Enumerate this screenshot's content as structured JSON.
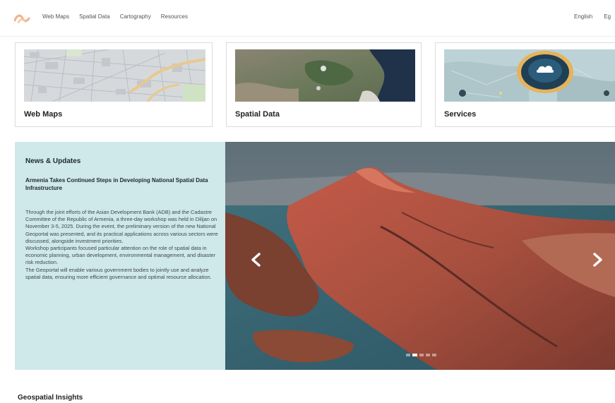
{
  "nav": {
    "links": [
      "Web Maps",
      "Spatial Data",
      "Cartography",
      "Resources"
    ],
    "languages": [
      "English",
      "Eg"
    ]
  },
  "cards": {
    "web_maps": "Web Maps",
    "spatial_data": "Spatial Data",
    "services": "Services"
  },
  "news": {
    "heading": "News & Updates",
    "subtitle": "Armenia Takes Continued Steps in Developing National Spatial Data Infrastructure",
    "paragraphs": [
      "Through the joint efforts of the Asian Development Bank (ADB) and the Cadastre Committee of the Republic of Armenia, a three-day workshop was held in Dilijan on November 3-5, 2025. During the event, the preliminary version of the new National Geoportal was presented, and its practical applications across various sectors were discussed, alongside investment priorities.",
      "Workshop participants focused particular attention on the role of spatial data in economic planning, urban development, environmental management, and disaster risk reduction.",
      "The Geoportal will enable various government bodies to jointly use and analyze spatial data, ensuring more efficient governance and optimal resource allocation."
    ]
  },
  "carousel": {
    "slide_count": 5,
    "active_index": 1
  },
  "section": {
    "title": "Geospatial Insights"
  }
}
